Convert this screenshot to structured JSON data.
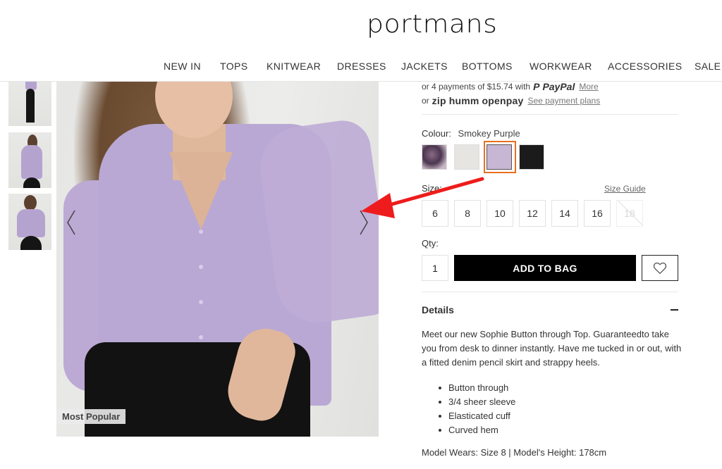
{
  "header": {
    "logo": "portmans",
    "nav": [
      "NEW IN",
      "TOPS",
      "KNITWEAR",
      "DRESSES",
      "JACKETS",
      "BOTTOMS",
      "WORKWEAR",
      "ACCESSORIES",
      "SALE"
    ]
  },
  "gallery": {
    "thumbnails": [
      "thumbnail-front-full",
      "thumbnail-back",
      "thumbnail-front-half"
    ],
    "badge": "Most Popular",
    "prev_icon": "chevron-left-icon",
    "next_icon": "chevron-right-icon"
  },
  "payment": {
    "line1_text": "or 4 payments of $15.74 with",
    "line1_brand": "PayPal",
    "line1_link": "More",
    "line2_prefix": "or",
    "line2_brands": [
      "zip",
      "humm",
      "openpay"
    ],
    "line2_link": "See payment plans"
  },
  "colour": {
    "label": "Colour:",
    "selected": "Smokey Purple",
    "swatches": [
      {
        "name": "Floral Print",
        "color": "#5a3e55"
      },
      {
        "name": "Ivory",
        "color": "#e6e5e1"
      },
      {
        "name": "Smokey Purple",
        "color": "#c7b6d4",
        "selected": true
      },
      {
        "name": "Black",
        "color": "#1c1b1b"
      }
    ],
    "accent_color": "#e8701f"
  },
  "size": {
    "label": "Size:",
    "guide_link": "Size Guide",
    "options": [
      {
        "label": "6",
        "available": true
      },
      {
        "label": "8",
        "available": true
      },
      {
        "label": "10",
        "available": true
      },
      {
        "label": "12",
        "available": true
      },
      {
        "label": "14",
        "available": true
      },
      {
        "label": "16",
        "available": true
      },
      {
        "label": "18",
        "available": false
      }
    ]
  },
  "qty": {
    "label": "Qty:",
    "value": "1"
  },
  "actions": {
    "add_to_bag": "ADD TO BAG",
    "wishlist_icon": "heart-icon"
  },
  "details": {
    "title": "Details",
    "toggle_icon": "minus-icon",
    "description": "Meet our new Sophie Button through Top. Guaranteedto take you from desk to dinner instantly. Have me tucked in or out, with a fitted denim pencil skirt and strappy heels.",
    "bullets": [
      "Button through",
      "3/4 sheer sleeve",
      "Elasticated cuff",
      "Curved hem"
    ],
    "model_info": "Model Wears: Size 8 | Model's Height: 178cm"
  },
  "annotation": {
    "arrow_color": "#ee1c1c"
  }
}
